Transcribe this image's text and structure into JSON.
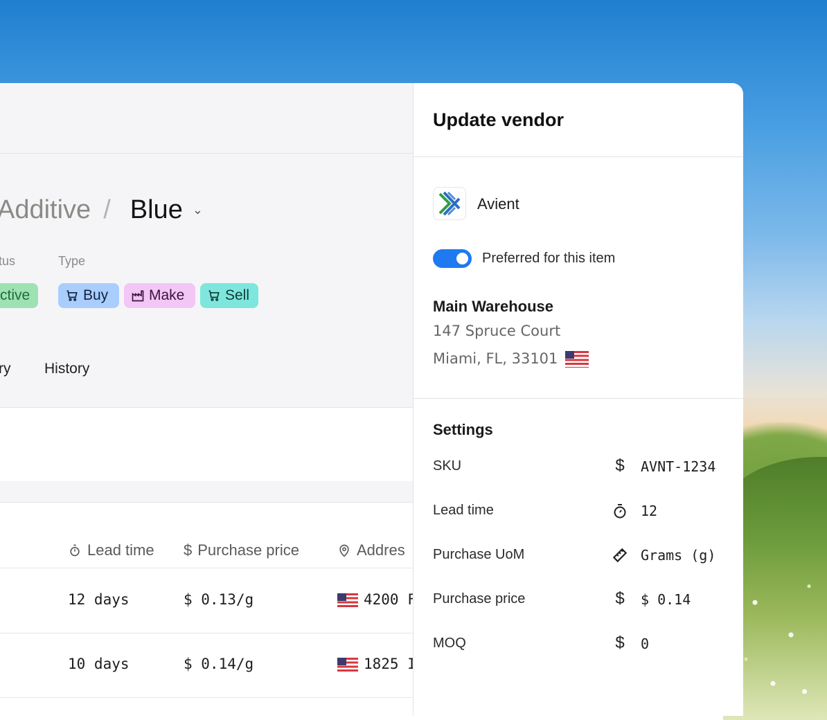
{
  "breadcrumb": {
    "parent": "Additive",
    "separator": "/",
    "current": "Blue"
  },
  "item": {
    "status_label": "tus",
    "status_value": "ctive",
    "type_label": "Type",
    "types": [
      {
        "label": "Buy",
        "icon": "cart-icon",
        "color": "#a9cdfd"
      },
      {
        "label": "Make",
        "icon": "factory-icon",
        "color": "#f3c6f6"
      },
      {
        "label": "Sell",
        "icon": "cart-icon",
        "color": "#7ee6dd"
      }
    ]
  },
  "tabs": [
    "ry",
    "History"
  ],
  "table": {
    "columns": [
      {
        "label": "Lead time",
        "icon": "stopwatch-icon"
      },
      {
        "label": "Purchase price",
        "icon": "dollar-icon"
      },
      {
        "label": "Addres",
        "icon": "location-pin-icon"
      }
    ],
    "rows": [
      {
        "lead_time": "12 days",
        "price": "$ 0.13/g",
        "address": "4200 F"
      },
      {
        "lead_time": "10 days",
        "price": "$ 0.14/g",
        "address": "1825 I"
      }
    ]
  },
  "panel": {
    "title": "Update vendor",
    "vendor": "Avient",
    "preferred_label": "Preferred for this item",
    "preferred": true,
    "warehouse": {
      "name": "Main Warehouse",
      "line1": "147 Spruce Court",
      "line2": "Miami, FL, 33101"
    },
    "settings_title": "Settings",
    "settings": [
      {
        "label": "SKU",
        "icon": "dollar-icon",
        "value": "AVNT-1234"
      },
      {
        "label": "Lead time",
        "icon": "stopwatch-icon",
        "value": "12"
      },
      {
        "label": "Purchase UoM",
        "icon": "ruler-icon",
        "value": "Grams (g)"
      },
      {
        "label": "Purchase price",
        "icon": "dollar-icon",
        "value": "$ 0.14"
      },
      {
        "label": "MOQ",
        "icon": "dollar-icon",
        "value": "0"
      }
    ]
  },
  "colors": {
    "accent": "#1f79f0",
    "status_green": "#9ee2b3"
  }
}
